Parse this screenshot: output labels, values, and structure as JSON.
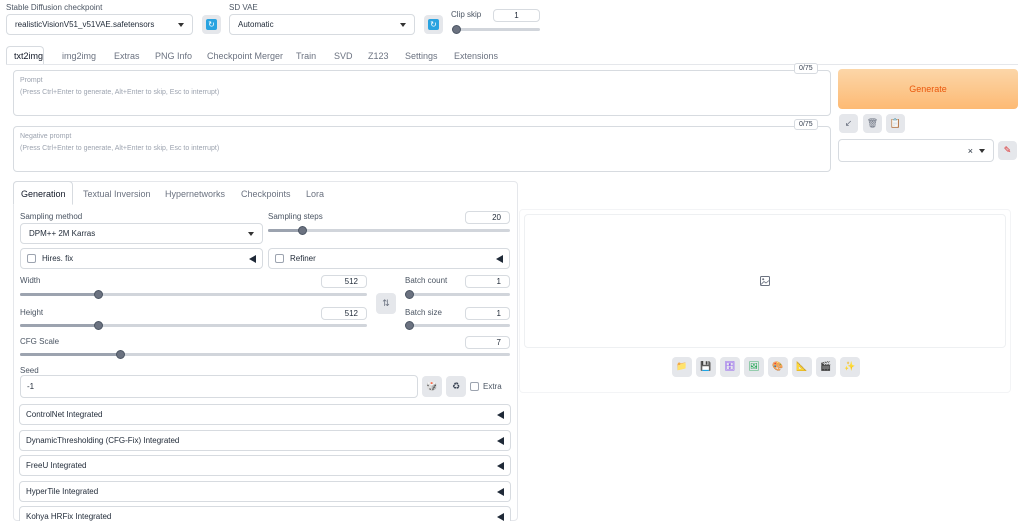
{
  "topbar": {
    "checkpoint_label": "Stable Diffusion checkpoint",
    "checkpoint_value": "realisticVisionV51_v51VAE.safetensors",
    "vae_label": "SD VAE",
    "vae_value": "Automatic",
    "clip_skip_label": "Clip skip",
    "clip_skip_value": "1"
  },
  "main_tabs": [
    "txt2img",
    "img2img",
    "Extras",
    "PNG Info",
    "Checkpoint Merger",
    "Train",
    "SVD",
    "Z123",
    "Settings",
    "Extensions"
  ],
  "prompt": {
    "label": "Prompt",
    "placeholder": "(Press Ctrl+Enter to generate, Alt+Enter to skip, Esc to interrupt)",
    "counter": "0/75"
  },
  "negative_prompt": {
    "label": "Negative prompt",
    "placeholder": "(Press Ctrl+Enter to generate, Alt+Enter to skip, Esc to interrupt)",
    "counter": "0/75"
  },
  "generate_label": "Generate",
  "styles_clear": "×",
  "sub_tabs": [
    "Generation",
    "Textual Inversion",
    "Hypernetworks",
    "Checkpoints",
    "Lora"
  ],
  "sampling": {
    "method_label": "Sampling method",
    "method_value": "DPM++ 2M Karras",
    "steps_label": "Sampling steps",
    "steps_value": "20",
    "steps_fraction": 0.13
  },
  "hires_fix_label": "Hires. fix",
  "refiner_label": "Refiner",
  "width": {
    "label": "Width",
    "value": "512",
    "fraction": 0.22
  },
  "height": {
    "label": "Height",
    "value": "512",
    "fraction": 0.22
  },
  "batch_count": {
    "label": "Batch count",
    "value": "1",
    "fraction": 0.0
  },
  "batch_size": {
    "label": "Batch size",
    "value": "1",
    "fraction": 0.0
  },
  "cfg": {
    "label": "CFG Scale",
    "value": "7",
    "fraction": 0.2
  },
  "seed": {
    "label": "Seed",
    "value": "-1",
    "extra_label": "Extra"
  },
  "accordions": [
    "ControlNet Integrated",
    "DynamicThresholding (CFG-Fix) Integrated",
    "FreeU Integrated",
    "HyperTile Integrated",
    "Kohya HRFix Integrated"
  ],
  "colors": {
    "generate_start": "#fcd6a8",
    "generate_end": "#fdba74",
    "generate_text": "#ea580c",
    "accent_blue": "#29a3e0"
  }
}
